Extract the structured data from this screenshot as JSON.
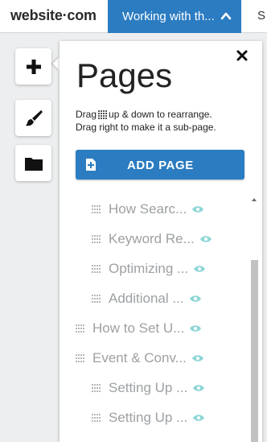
{
  "header": {
    "logo": "website·com",
    "current_page": "Working with th...",
    "cut_text": "S"
  },
  "tools": [
    {
      "name": "add-element-button",
      "icon": "plus-icon"
    },
    {
      "name": "design-button",
      "icon": "paintbrush-icon"
    },
    {
      "name": "files-button",
      "icon": "folder-icon"
    }
  ],
  "panel": {
    "title": "Pages",
    "help_line1_before": "Drag",
    "help_line1_after": "up & down to rearrange.",
    "help_line2": "Drag right to make it a sub-page.",
    "add_page_label": "ADD PAGE",
    "close_icon": "close-icon"
  },
  "pages": [
    {
      "title": "How Searc...",
      "indent": 1
    },
    {
      "title": "Keyword Re...",
      "indent": 1
    },
    {
      "title": "Optimizing ...",
      "indent": 1
    },
    {
      "title": "Additional ...",
      "indent": 1
    },
    {
      "title": "How to Set U...",
      "indent": 0
    },
    {
      "title": "Event & Conv...",
      "indent": 0
    },
    {
      "title": "Setting Up ...",
      "indent": 1
    },
    {
      "title": "Setting Up ...",
      "indent": 1
    }
  ],
  "colors": {
    "accent": "#2b7cc1",
    "eye": "#8fd6d8",
    "page_text": "#9da0a3"
  }
}
